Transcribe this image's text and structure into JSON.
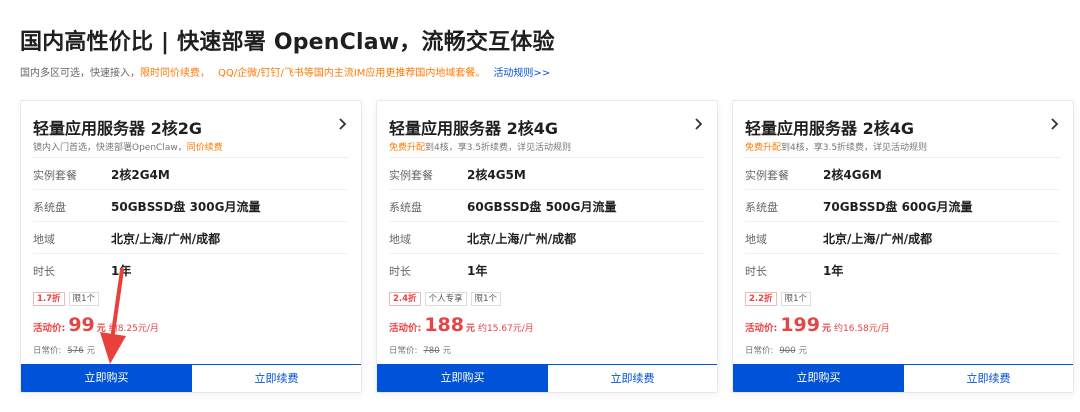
{
  "header": {
    "title": "国内高性价比 | 快速部署 OpenClaw，流畅交互体验",
    "subtitle_part1": "国内多区可选，快速接入，",
    "subtitle_part2": "限时同价续费，",
    "subtitle_part3": "QQ/企微/钉钉/飞书等国内主流IM应用更推荐国内地域套餐。",
    "subtitle_link": "活动规则>>"
  },
  "labels": {
    "spec_instance": "实例套餐",
    "spec_disk": "系统盘",
    "spec_region": "地域",
    "spec_duration": "时长",
    "activity_price": "活动价:",
    "yuan": "元",
    "daily_price": "日常价:",
    "buy_button": "立即购买",
    "renew_button": "立即续费"
  },
  "cards": [
    {
      "title": "轻量应用服务器 2核2G",
      "desc_normal1": "镜内入门首选，快速部署OpenClaw，",
      "desc_orange": "同价续费",
      "desc_normal2": "",
      "instance": "2核2G4M",
      "disk": "50GBSSD盘 300G月流量",
      "region": "北京/上海/广州/成都",
      "duration": "1年",
      "tags": [
        "1.7折",
        "限1个"
      ],
      "price": "99",
      "monthly": "约8.25元/月",
      "original": "576"
    },
    {
      "title": "轻量应用服务器 2核4G",
      "desc_normal1": "",
      "desc_orange": "免费升配",
      "desc_normal2": "到4核，享3.5折续费，详见活动规则",
      "instance": "2核4G5M",
      "disk": "60GBSSD盘 500G月流量",
      "region": "北京/上海/广州/成都",
      "duration": "1年",
      "tags": [
        "2.4折",
        "个人专享",
        "限1个"
      ],
      "price": "188",
      "monthly": "约15.67元/月",
      "original": "780"
    },
    {
      "title": "轻量应用服务器 2核4G",
      "desc_normal1": "",
      "desc_orange": "免费升配",
      "desc_normal2": "到4核，享3.5折续费，详见活动规则",
      "instance": "2核4G6M",
      "disk": "70GBSSD盘 600G月流量",
      "region": "北京/上海/广州/成都",
      "duration": "1年",
      "tags": [
        "2.2折",
        "限1个"
      ],
      "price": "199",
      "monthly": "约16.58元/月",
      "original": "900"
    }
  ],
  "icons": {
    "chevron": "chevron-right-icon",
    "annotation": "red-arrow-annotation"
  },
  "colors": {
    "primary_blue": "#0052d9",
    "price_red": "#e54545",
    "promo_orange": "#ff7a00",
    "annotation_red": "#e8413c"
  }
}
